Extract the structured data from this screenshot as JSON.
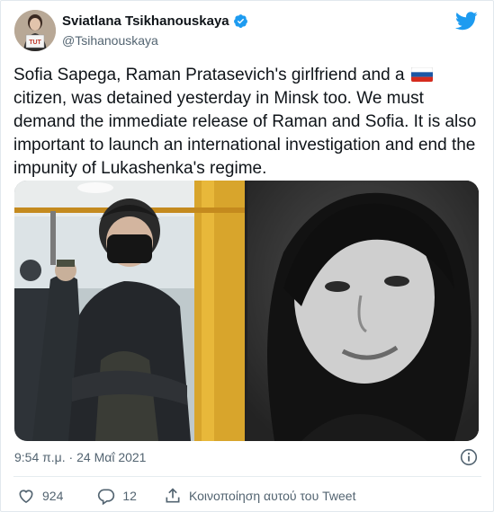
{
  "author": {
    "display_name": "Sviatlana Tsikhanouskaya",
    "handle": "@Tsihanouskaya",
    "avatar_sign_text": "TUT",
    "verified": true
  },
  "tweet": {
    "text_part1": "Sofia Sapega, Raman Pratasevich's girlfriend and a",
    "flag_icon": "russia-flag-icon",
    "text_part2": "citizen, was detained yesterday in Minsk too. We must demand the immediate release of Raman and Sofia. It is also important to launch an international investigation and end the impunity of Lukashenka's regime."
  },
  "media": {
    "photo_count": 2
  },
  "meta": {
    "time": "9:54 π.μ.",
    "separator": "·",
    "date": "24 Μαΐ 2021"
  },
  "actions": {
    "like_count": "924",
    "reply_count": "12",
    "share_label": "Κοινοποίηση αυτού του Tweet"
  },
  "colors": {
    "brand_blue": "#1d9bf0",
    "text_primary": "#0f1419",
    "text_secondary": "#536471",
    "divider": "#e6ecf0"
  }
}
